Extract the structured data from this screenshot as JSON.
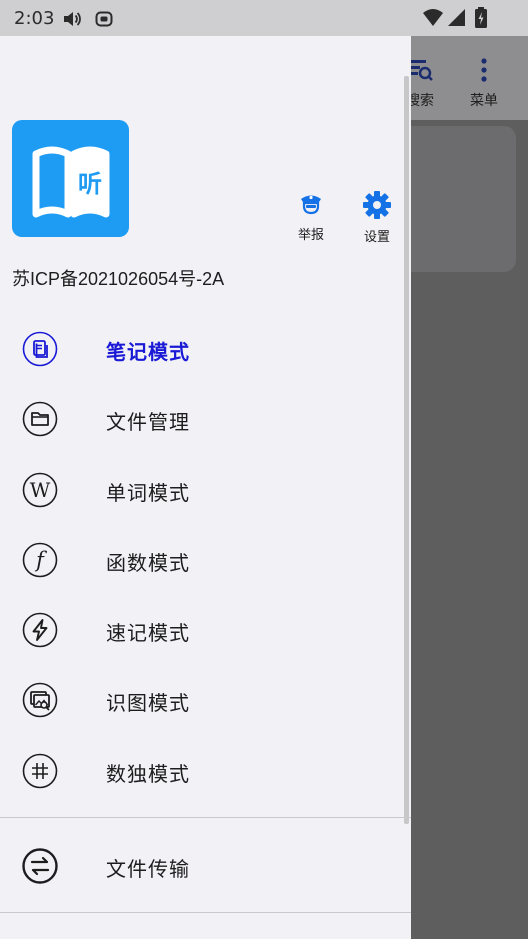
{
  "status_bar": {
    "time": "2:03",
    "icons": [
      "volume-icon",
      "app-notification-icon",
      "wifi-icon",
      "cell-signal-icon",
      "battery-icon"
    ]
  },
  "background_app": {
    "search_label": "搜索",
    "menu_label": "菜单"
  },
  "drawer": {
    "logo_text": "听",
    "report_label": "举报",
    "settings_label": "设置",
    "icp": "苏ICP备2021026054号-2A",
    "items": [
      {
        "label": "笔记模式",
        "icon": "note-icon",
        "active": true
      },
      {
        "label": "文件管理",
        "icon": "folder-icon",
        "active": false
      },
      {
        "label": "单词模式",
        "icon": "word-w-icon",
        "active": false
      },
      {
        "label": "函数模式",
        "icon": "function-icon",
        "active": false
      },
      {
        "label": "速记模式",
        "icon": "lightning-icon",
        "active": false
      },
      {
        "label": "识图模式",
        "icon": "image-search-icon",
        "active": false
      },
      {
        "label": "数独模式",
        "icon": "hash-icon",
        "active": false
      }
    ],
    "transfer_label": "文件传输"
  },
  "colors": {
    "accent": "#1a1ad6",
    "logo_blue": "#1e9bf2",
    "settings_blue": "#1472e6",
    "drawer_bg": "#f2f2f6"
  }
}
